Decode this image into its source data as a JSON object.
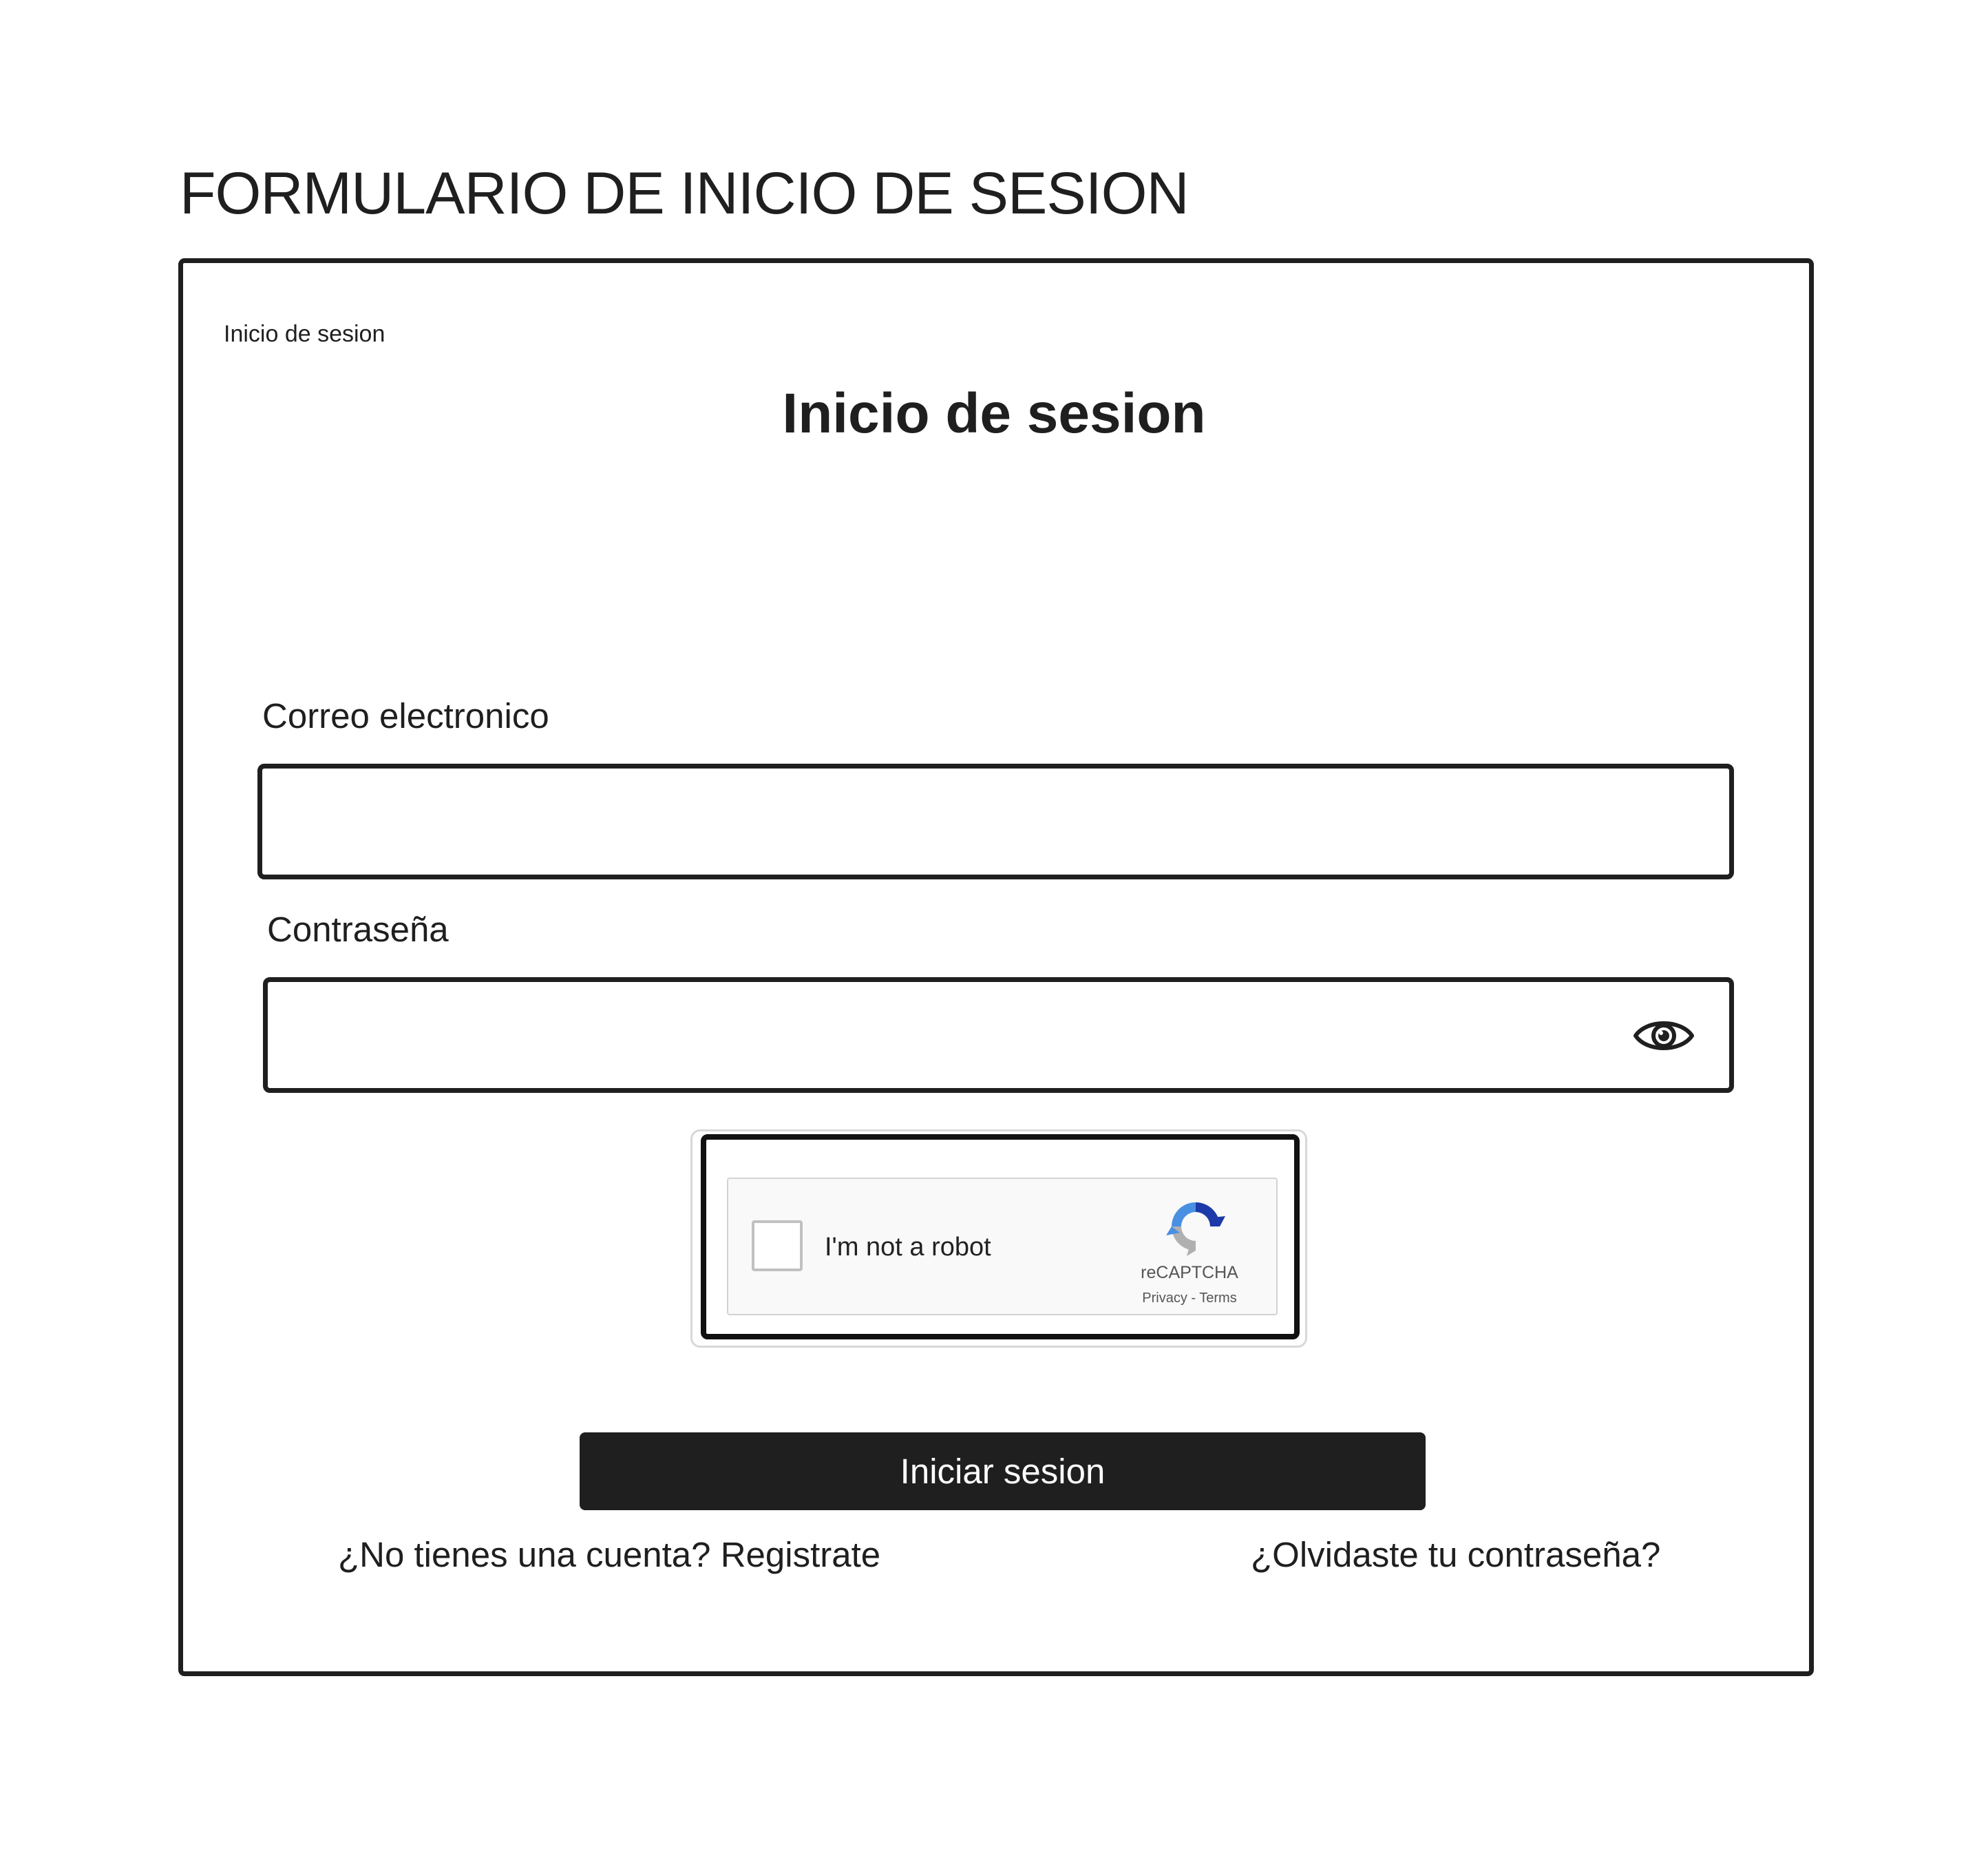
{
  "page": {
    "title": "FORMULARIO DE INICIO DE SESION"
  },
  "frame": {
    "label": "Inicio de sesion"
  },
  "form": {
    "heading": "Inicio de sesion",
    "email": {
      "label": "Correo electronico",
      "value": "",
      "placeholder": ""
    },
    "password": {
      "label": "Contraseña",
      "value": "",
      "placeholder": "",
      "toggle_icon": "eye-icon"
    },
    "captcha": {
      "checkbox_label": "I'm not a robot",
      "brand": "reCAPTCHA",
      "privacy_link": "Privacy",
      "separator": " - ",
      "terms_link": "Terms",
      "checked": false
    },
    "submit_label": "Iniciar sesion",
    "register_link": "¿No tienes una cuenta? Registrate",
    "forgot_link": "¿Olvidaste tu contraseña?"
  },
  "colors": {
    "text": "#1f1f1f",
    "button_bg": "#1f1f1f",
    "button_text": "#ffffff",
    "border": "#1f1f1f",
    "captcha_bg": "#f9f9f9",
    "captcha_blue": "#1c3aa9",
    "captcha_light_blue": "#4a90e2",
    "captcha_gray": "#b0b0b0"
  }
}
